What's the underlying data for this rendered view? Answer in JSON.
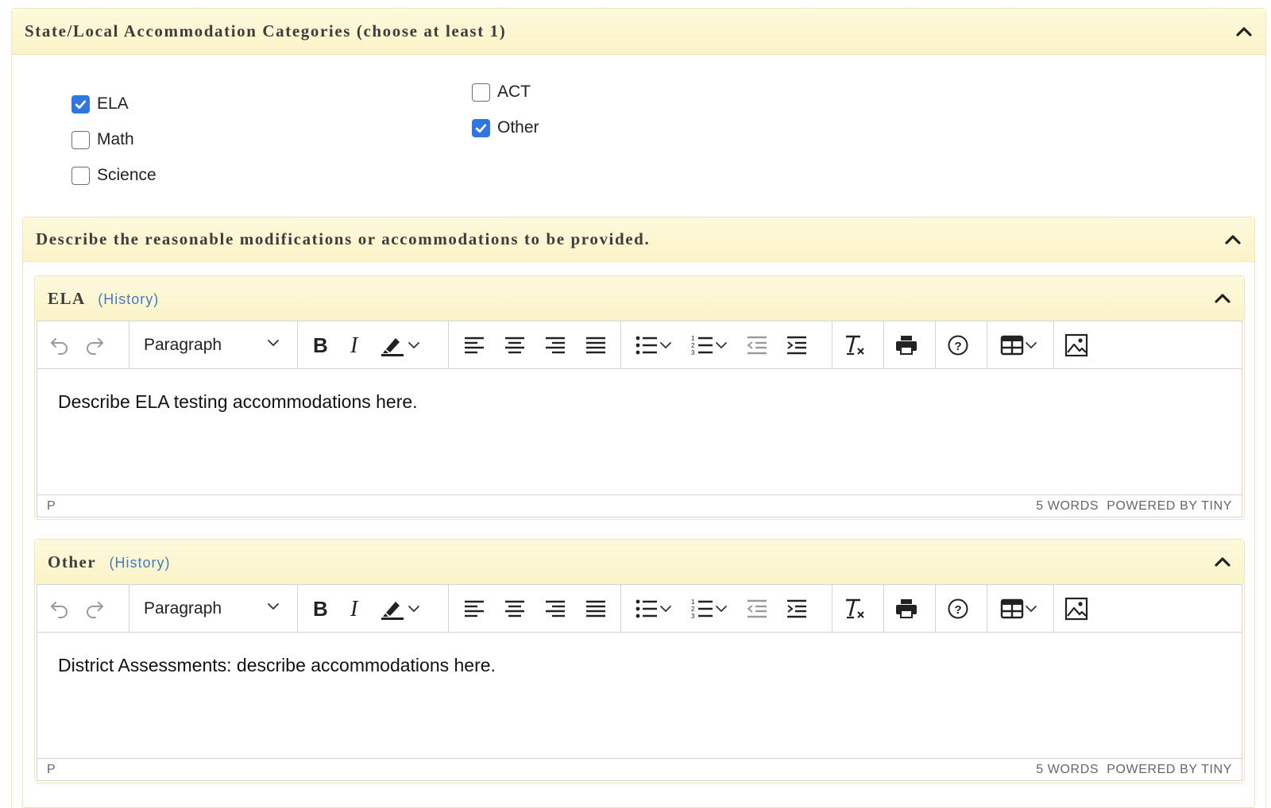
{
  "categories": {
    "title": "State/Local Accommodation Categories (choose at least 1)",
    "options": [
      {
        "label": "ELA",
        "checked": true
      },
      {
        "label": "Math",
        "checked": false
      },
      {
        "label": "Science",
        "checked": false
      },
      {
        "label": "ACT",
        "checked": false
      },
      {
        "label": "Other",
        "checked": true
      }
    ]
  },
  "modifications": {
    "title": "Describe the reasonable modifications or accommodations to be provided."
  },
  "editors": [
    {
      "title": "ELA",
      "history_label": "(History)",
      "format_label": "Paragraph",
      "content": "Describe ELA testing accommodations here.",
      "path": "P",
      "word_count": "5 WORDS",
      "powered_by": "POWERED BY TINY"
    },
    {
      "title": "Other",
      "history_label": "(History)",
      "format_label": "Paragraph",
      "content": "District Assessments:  describe accommodations here.",
      "path": "P",
      "word_count": "5 WORDS",
      "powered_by": "POWERED BY TINY"
    }
  ],
  "toolbar_icons": [
    "undo-icon",
    "redo-icon",
    "bold-icon",
    "italic-icon",
    "highlight-icon",
    "align-left-icon",
    "align-center-icon",
    "align-right-icon",
    "justify-icon",
    "bullet-list-icon",
    "numbered-list-icon",
    "outdent-icon",
    "indent-icon",
    "clear-format-icon",
    "print-icon",
    "help-icon",
    "table-icon",
    "image-icon"
  ],
  "colors": {
    "header_bg": "#fbf3c8",
    "checkbox_on": "#2f76e0",
    "history_link": "#3f7cc0"
  }
}
